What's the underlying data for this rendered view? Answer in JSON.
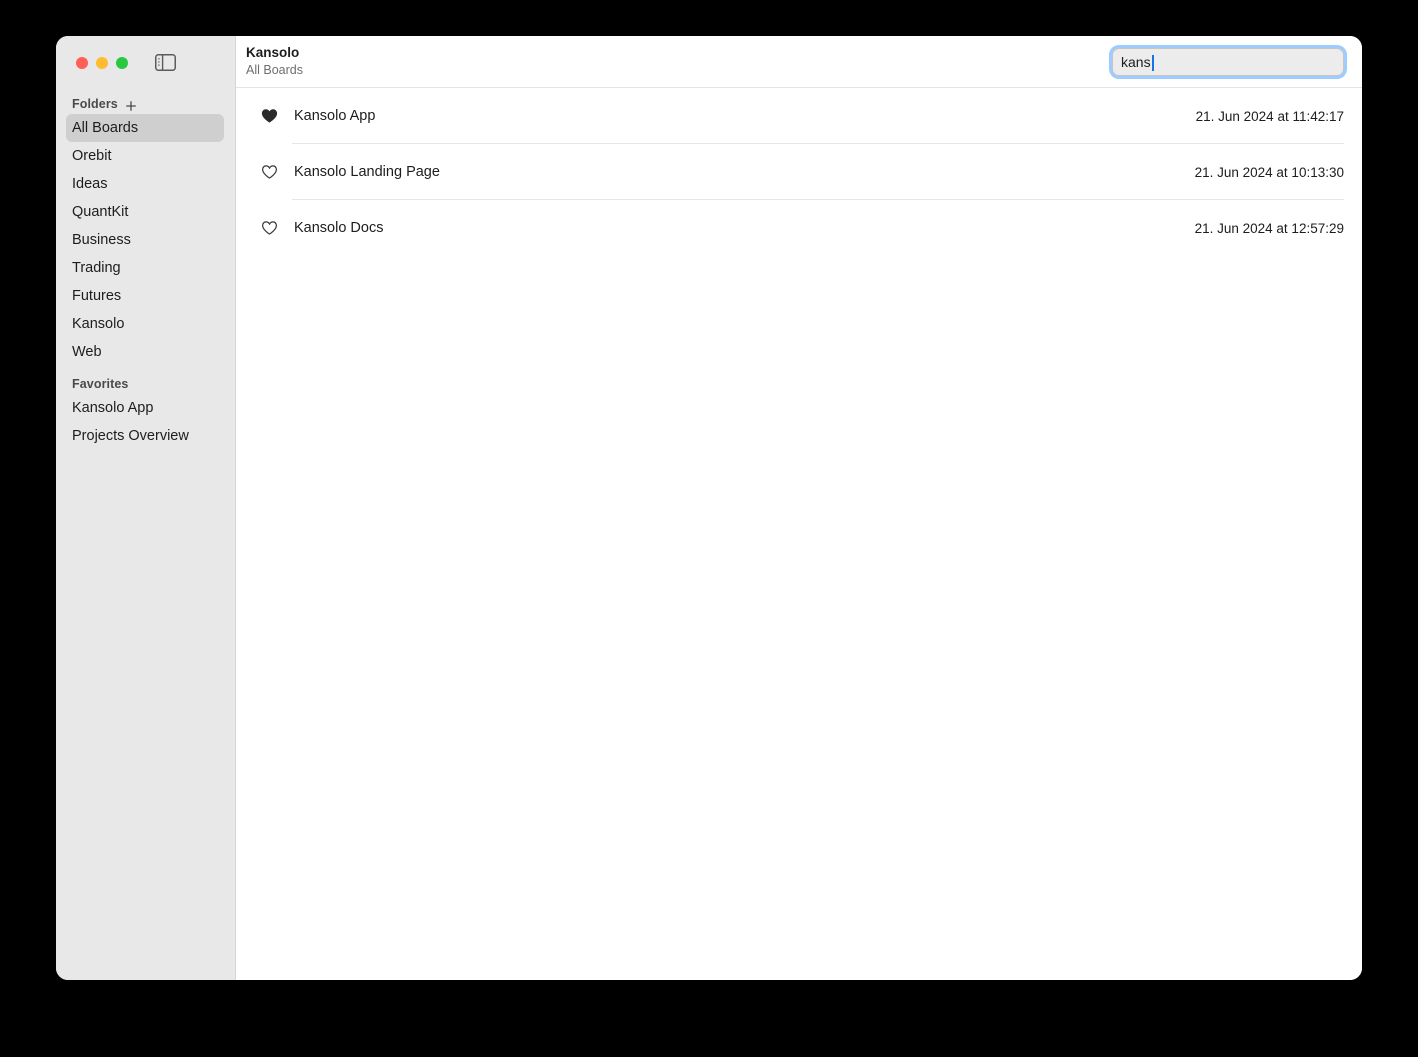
{
  "window": {
    "traffic_lights": {
      "close": "close-button",
      "minimize": "minimize-button",
      "maximize": "maximize-button"
    },
    "sidebar_toggle_icon": "sidebar-toggle-icon"
  },
  "sidebar": {
    "groups": [
      {
        "label": "Folders",
        "add_icon": "plus-icon",
        "items": [
          {
            "label": "All Boards",
            "selected": true
          },
          {
            "label": "Orebit",
            "selected": false
          },
          {
            "label": "Ideas",
            "selected": false
          },
          {
            "label": "QuantKit",
            "selected": false
          },
          {
            "label": "Business",
            "selected": false
          },
          {
            "label": "Trading",
            "selected": false
          },
          {
            "label": "Futures",
            "selected": false
          },
          {
            "label": "Kansolo",
            "selected": false
          },
          {
            "label": "Web",
            "selected": false
          }
        ]
      },
      {
        "label": "Favorites",
        "items": [
          {
            "label": "Kansolo App",
            "selected": false
          },
          {
            "label": "Projects Overview",
            "selected": false
          }
        ]
      }
    ]
  },
  "toolbar": {
    "title": "Kansolo",
    "subtitle": "All Boards",
    "search": {
      "value": "kans",
      "placeholder": "Search"
    }
  },
  "results": {
    "rows": [
      {
        "favorite_icon": "heart-filled-icon",
        "favorite": true,
        "name": "Kansolo App",
        "date": "21. Jun 2024 at 11:42:17"
      },
      {
        "favorite_icon": "heart-outline-icon",
        "favorite": false,
        "name": "Kansolo Landing Page",
        "date": "21. Jun 2024 at 10:13:30"
      },
      {
        "favorite_icon": "heart-outline-icon",
        "favorite": false,
        "name": "Kansolo Docs",
        "date": "21. Jun 2024 at 12:57:29"
      }
    ]
  },
  "colors": {
    "sidebar_bg": "#e8e8e8",
    "selection": "#cfcfcf",
    "accent_focus": "#007aff",
    "caret": "#1473e6",
    "traffic_close": "#ff5f57",
    "traffic_min": "#febc2e",
    "traffic_max": "#28c840",
    "text_primary": "#1d1d1f",
    "text_secondary": "#6e6e73"
  }
}
